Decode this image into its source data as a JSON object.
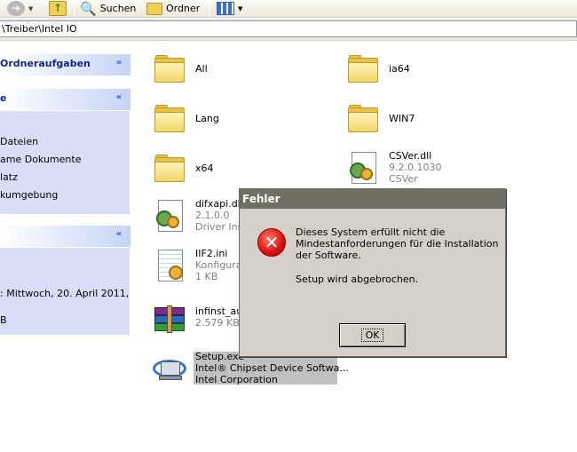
{
  "toolbar": {
    "search_label": "Suchen",
    "folders_label": "Ordner"
  },
  "address": {
    "value": "\\Treiber\\Intel IO"
  },
  "taskpane": {
    "folder_tasks_header": "Ordneraufgaben",
    "other_places_header": "e",
    "other_places_links": [
      "Dateien",
      "ame Dokumente",
      "latz",
      "kumgebung"
    ],
    "details_header": "",
    "details_lines": [
      ": Mittwoch, 20. April 2011,",
      "B"
    ]
  },
  "files": [
    {
      "name": "All",
      "type": "folder"
    },
    {
      "name": "ia64",
      "type": "folder"
    },
    {
      "name": "Lang",
      "type": "folder"
    },
    {
      "name": "WIN7",
      "type": "folder"
    },
    {
      "name": "x64",
      "type": "folder"
    },
    {
      "name": "CSVer.dll",
      "type": "dll",
      "line2": "9.2.0.1030",
      "line3": "CSVer"
    },
    {
      "name": "difxapi.dll",
      "type": "dll",
      "line2": "2.1.0.0",
      "line3": "Driver Ins"
    },
    {
      "name": "IIF2.ini",
      "type": "ini",
      "line2": "Konfigura",
      "line3": "1 KB"
    },
    {
      "name": "infinst_au",
      "type": "rar",
      "line2": "2.579 KB"
    },
    {
      "name": "Setup.exe",
      "type": "exe",
      "line2": "Intel® Chipset Device Softwa...",
      "line3": "Intel Corporation"
    }
  ],
  "dialog": {
    "title": "Fehler",
    "message": "Dieses System erfüllt nicht die Mindestanforderungen für die Installation der Software.",
    "message2": "Setup wird abgebrochen.",
    "ok_label": "OK",
    "icon": "error-icon"
  }
}
